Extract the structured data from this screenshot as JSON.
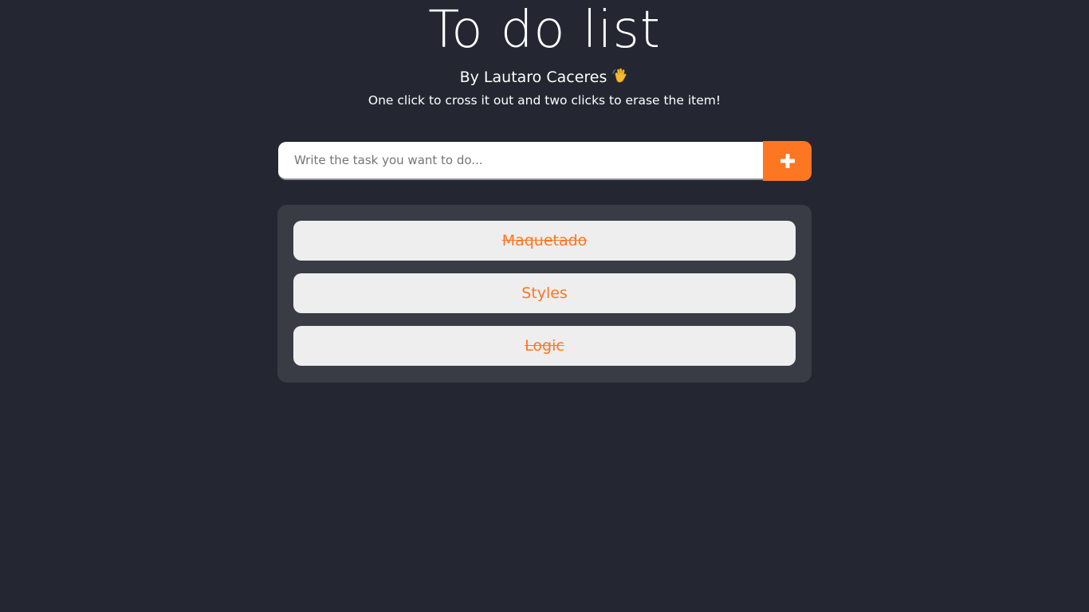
{
  "header": {
    "title": "To do list",
    "author": "By Lautaro Caceres",
    "author_icon": "waving-hand-icon",
    "instructions": "One click to cross it out and two clicks to erase the item!"
  },
  "form": {
    "placeholder": "Write the task you want to do...",
    "value": "",
    "add_icon": "plus-icon"
  },
  "tasks": [
    {
      "label": "Maquetado",
      "done": true
    },
    {
      "label": "Styles",
      "done": false
    },
    {
      "label": "Logic",
      "done": true
    }
  ],
  "colors": {
    "background": "#242731",
    "panel": "#393c45",
    "accent": "#fd7622",
    "item": "#eeeeee"
  }
}
